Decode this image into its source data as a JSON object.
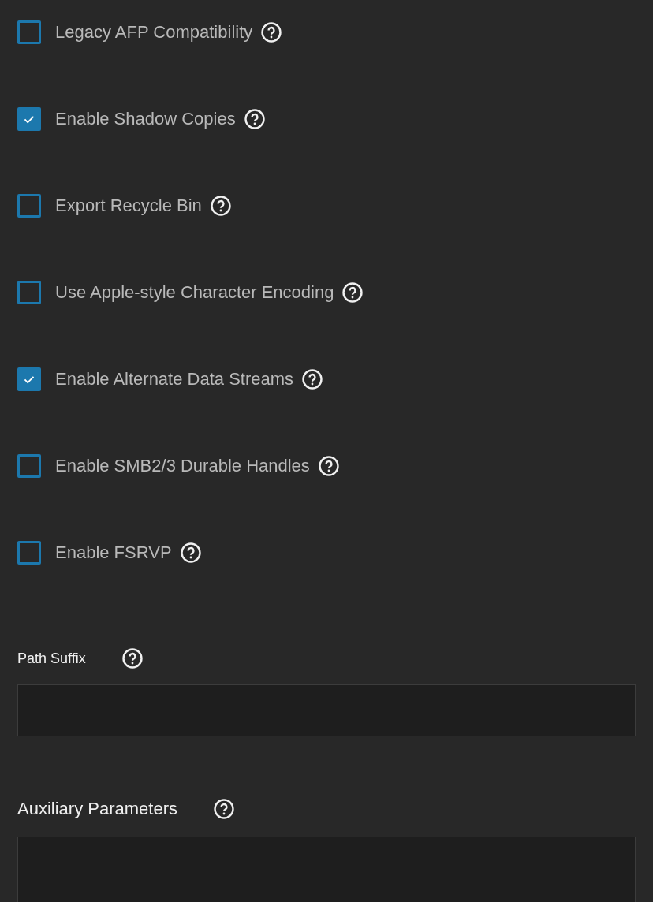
{
  "options": [
    {
      "label": "Legacy AFP Compatibility",
      "checked": false
    },
    {
      "label": "Enable Shadow Copies",
      "checked": true
    },
    {
      "label": "Export Recycle Bin",
      "checked": false
    },
    {
      "label": "Use Apple-style Character Encoding",
      "checked": false
    },
    {
      "label": "Enable Alternate Data Streams",
      "checked": true
    },
    {
      "label": "Enable SMB2/3 Durable Handles",
      "checked": false
    },
    {
      "label": "Enable FSRVP",
      "checked": false
    }
  ],
  "fields": [
    {
      "label": "Path Suffix",
      "kind": "input"
    },
    {
      "label": "Auxiliary Parameters",
      "kind": "textarea"
    }
  ]
}
